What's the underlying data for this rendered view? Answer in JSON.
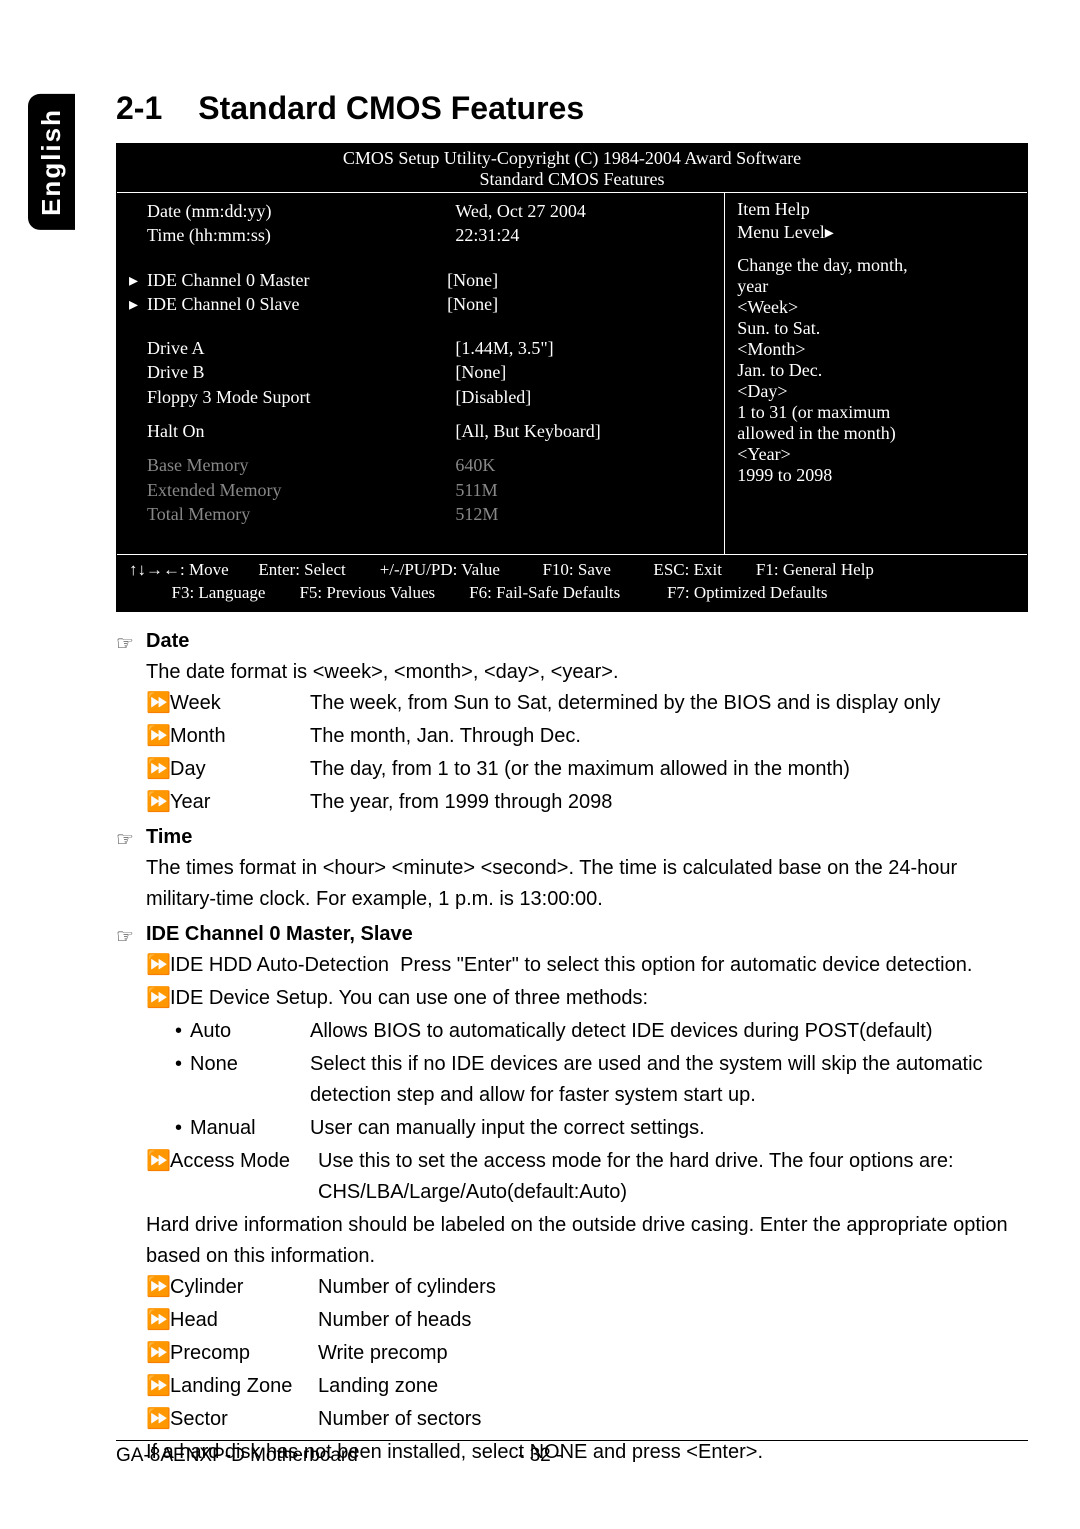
{
  "tab_label": "English",
  "heading_num": "2-1",
  "heading_text": "Standard CMOS Features",
  "bios": {
    "title_line1": "CMOS Setup Utility-Copyright (C) 1984-2004 Award Software",
    "title_line2": "Standard CMOS Features",
    "rows": {
      "date": {
        "label": "Date (mm:dd:yy)",
        "value": "Wed, Oct 27 2004"
      },
      "time": {
        "label": "Time (hh:mm:ss)",
        "value": "22:31:24"
      },
      "ide0m": {
        "label": "IDE Channel 0 Master",
        "value": "[None]"
      },
      "ide0s": {
        "label": "IDE Channel 0 Slave",
        "value": "[None]"
      },
      "driveA": {
        "label": "Drive A",
        "value": "[1.44M, 3.5\"]"
      },
      "driveB": {
        "label": "Drive B",
        "value": "[None]"
      },
      "floppy3": {
        "label": "Floppy 3 Mode Suport",
        "value": "[Disabled]"
      },
      "halt": {
        "label": "Halt On",
        "value": "[All, But Keyboard]"
      },
      "basemem": {
        "label": "Base Memory",
        "value": "640K"
      },
      "extmem": {
        "label": "Extended Memory",
        "value": "511M"
      },
      "totmem": {
        "label": "Total Memory",
        "value": "512M"
      }
    },
    "help": {
      "title": "Item Help",
      "menu": "Menu Level▸",
      "lines": [
        "Change the day, month,",
        "year",
        "",
        "<Week>",
        "Sun. to Sat.",
        "",
        "<Month>",
        "Jan. to Dec.",
        "",
        "<Day>",
        "1 to 31 (or maximum",
        "allowed in the month)",
        "",
        "<Year>",
        "1999 to 2098"
      ]
    },
    "footer": {
      "l1": "↑↓→←: Move       Enter: Select        +/-/PU/PD: Value          F10: Save          ESC: Exit        F1: General Help",
      "l2": "          F3: Language        F5: Previous Values        F6: Fail-Safe Defaults           F7: Optimized Defaults"
    }
  },
  "sections": {
    "date": {
      "title": "Date",
      "intro": "The date format is <week>, <month>, <day>, <year>.",
      "items": [
        {
          "term": "Week",
          "desc": "The week, from Sun to Sat, determined by the BIOS and is display only"
        },
        {
          "term": "Month",
          "desc": "The month, Jan. Through Dec."
        },
        {
          "term": "Day",
          "desc": "The day, from 1 to 31 (or the maximum allowed in the month)"
        },
        {
          "term": "Year",
          "desc": "The year, from 1999 through 2098"
        }
      ]
    },
    "time": {
      "title": "Time",
      "para": "The times format in <hour> <minute> <second>. The time is calculated base on the 24-hour military-time clock. For example, 1 p.m. is 13:00:00."
    },
    "ide": {
      "title": "IDE Channel 0 Master, Slave",
      "line1_term": "IDE HDD Auto-Detection",
      "line1_desc": "Press \"Enter\" to select this option for automatic device detection.",
      "line2": "IDE Device Setup.  You can use one of three methods:",
      "methods": [
        {
          "term": "Auto",
          "desc": "Allows BIOS to automatically detect IDE devices during POST(default)"
        },
        {
          "term": "None",
          "desc": "Select this if no IDE devices are used and the system will skip the automatic detection step and allow for faster system start up."
        },
        {
          "term": "Manual",
          "desc": "User can manually input the correct settings."
        }
      ],
      "access_term": "Access Mode",
      "access_desc": "Use this to set the access mode for the hard drive. The four options are: CHS/LBA/Large/Auto(default:Auto)",
      "hd_info": "Hard drive information should be labeled on the outside drive casing.  Enter the appropriate option based on this information.",
      "fields": [
        {
          "term": "Cylinder",
          "desc": "Number of cylinders"
        },
        {
          "term": "Head",
          "desc": "Number of heads"
        },
        {
          "term": "Precomp",
          "desc": "Write precomp"
        },
        {
          "term": "Landing Zone",
          "desc": "Landing zone"
        },
        {
          "term": "Sector",
          "desc": "Number of sectors"
        }
      ],
      "closing": "If a hard disk has not been installed, select NONE and press <Enter>."
    }
  },
  "footer": {
    "left": "GA-8AENXP-D Motherboard",
    "page": "- 32 -"
  },
  "glyphs": {
    "hand": "☞",
    "darrow": "⏩",
    "bullet": "•",
    "triangle": "▸"
  }
}
